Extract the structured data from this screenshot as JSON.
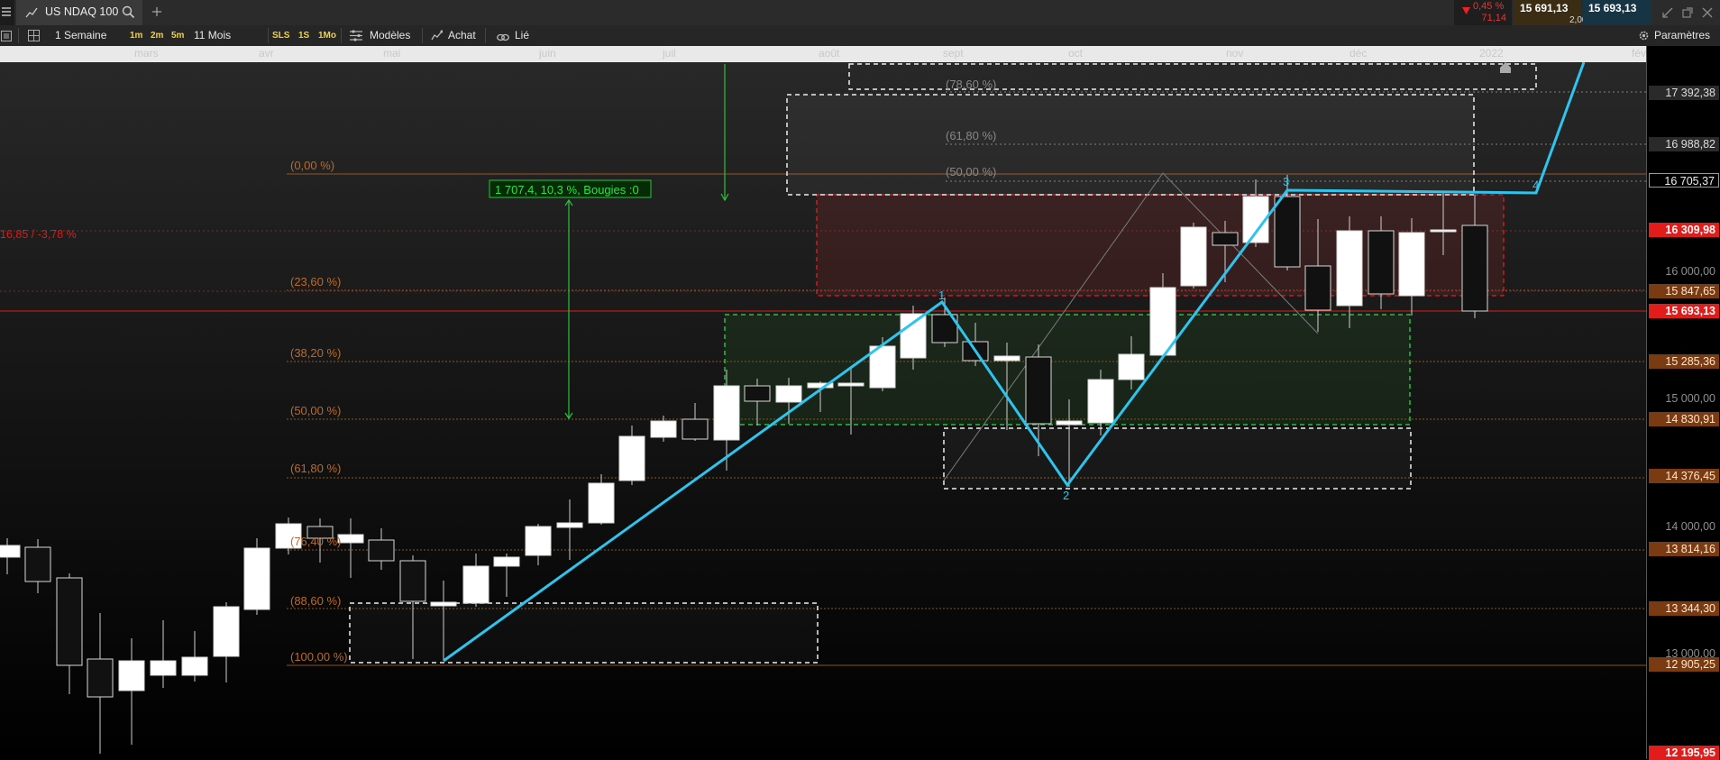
{
  "tab": {
    "symbol": "US NDAQ 100"
  },
  "quote": {
    "change_pct": "0,45 %",
    "change_abs": "71,14",
    "bid": "15 691,13",
    "ask": "15 693,13",
    "spread": "2,00"
  },
  "toolbar": {
    "period": "1 Semaine",
    "res_1m": "1m",
    "res_2m": "2m",
    "res_5m": "5m",
    "range": "11 Mois",
    "res_sls": "SLS",
    "res_1s": "1S",
    "res_1mo": "1Mo",
    "models": "Modèles",
    "buy": "Achat",
    "linked": "Lié",
    "settings": "Paramètres"
  },
  "months": [
    "mars",
    "avr",
    "mai",
    "juin",
    "juil",
    "août",
    "sept",
    "oct",
    "nov",
    "déc",
    "2022",
    "févr"
  ],
  "price_axis": [
    "17 392,38",
    "16 988,82",
    "16 705,37",
    "16 309,98",
    "16 000,00",
    "15 847,65",
    "15 693,13",
    "15 285,36",
    "15 000,00",
    "14 830,91",
    "14 376,45",
    "14 000,00",
    "13 814,16",
    "13 344,30",
    "13 000,00",
    "12 905,25",
    "12 195,95"
  ],
  "fib_left": [
    "(0,00 %)",
    "(23,60 %)",
    "(38,20 %)",
    "(50,00 %)",
    "(61,80 %)",
    "(76,40 %)",
    "(88,60 %)",
    "(100,00 %)"
  ],
  "fib_right": [
    "(78,60 %)",
    "(61,80 %)",
    "(50,00 %)"
  ],
  "measure_label": "1 707,4, 10,3 %, Bougies :0",
  "alert_label": "16,85 / -3,78 %",
  "wave_labels": [
    "1",
    "2",
    "3",
    "4"
  ],
  "colors": {
    "up": "#ffffff",
    "down": "#111111",
    "zigzag": "#2ec4ee",
    "fib": "#b86a2e",
    "current": "#e21b1b",
    "green_box": "#23c23a"
  },
  "icons": [
    "menu-icon",
    "chart-line-icon",
    "search-icon",
    "plus-icon",
    "list-icon",
    "grid-icon",
    "templates-icon",
    "buy-icon",
    "link-icon",
    "gear-icon",
    "arrow-down-icon",
    "window-restore-icon",
    "window-popout-icon",
    "close-icon"
  ]
}
